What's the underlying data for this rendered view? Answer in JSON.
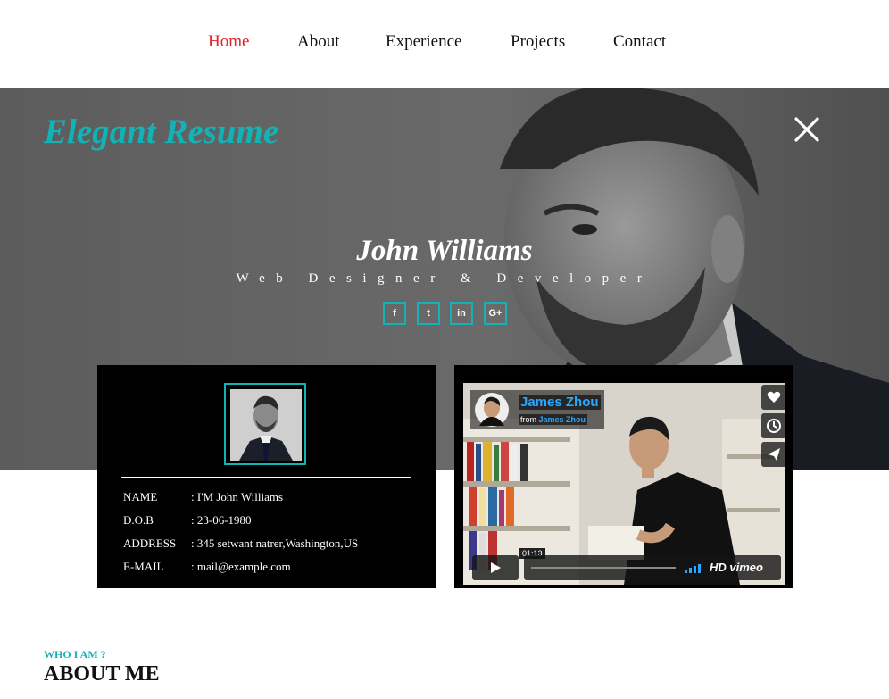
{
  "nav": {
    "items": [
      "Home",
      "About",
      "Experience",
      "Projects",
      "Contact"
    ],
    "active": "Home"
  },
  "hero": {
    "brand": "Elegant Resume",
    "name": "John Williams",
    "role": "Web Designer & Developer",
    "close_icon": "close-icon",
    "social": [
      {
        "icon": "facebook-icon",
        "glyph": "f"
      },
      {
        "icon": "twitter-icon",
        "glyph": "t"
      },
      {
        "icon": "linkedin-icon",
        "glyph": "in"
      },
      {
        "icon": "google-plus-icon",
        "glyph": "G+"
      }
    ]
  },
  "profile": {
    "rows": [
      {
        "label": "NAME",
        "value": ": I'M John Williams"
      },
      {
        "label": "D.O.B",
        "value": ": 23-06-1980"
      },
      {
        "label": "ADDRESS",
        "value": ": 345 setwant natrer,Washington,US"
      },
      {
        "label": "E-MAIL",
        "value": ": mail@example.com"
      }
    ]
  },
  "video": {
    "author": "James Zhou",
    "from_prefix": "from",
    "from_name": "James Zhou",
    "time": "01:13",
    "hd": "HD",
    "brand": "vimeo",
    "progress": 0.0,
    "side_icons": [
      "heart-icon",
      "clock-icon",
      "send-icon"
    ]
  },
  "about": {
    "kicker": "WHO I AM ?",
    "title": "ABOUT ME"
  },
  "colors": {
    "accent": "#11b3b7",
    "active_nav": "#e4202b",
    "video_blue": "#2aa8ff"
  }
}
